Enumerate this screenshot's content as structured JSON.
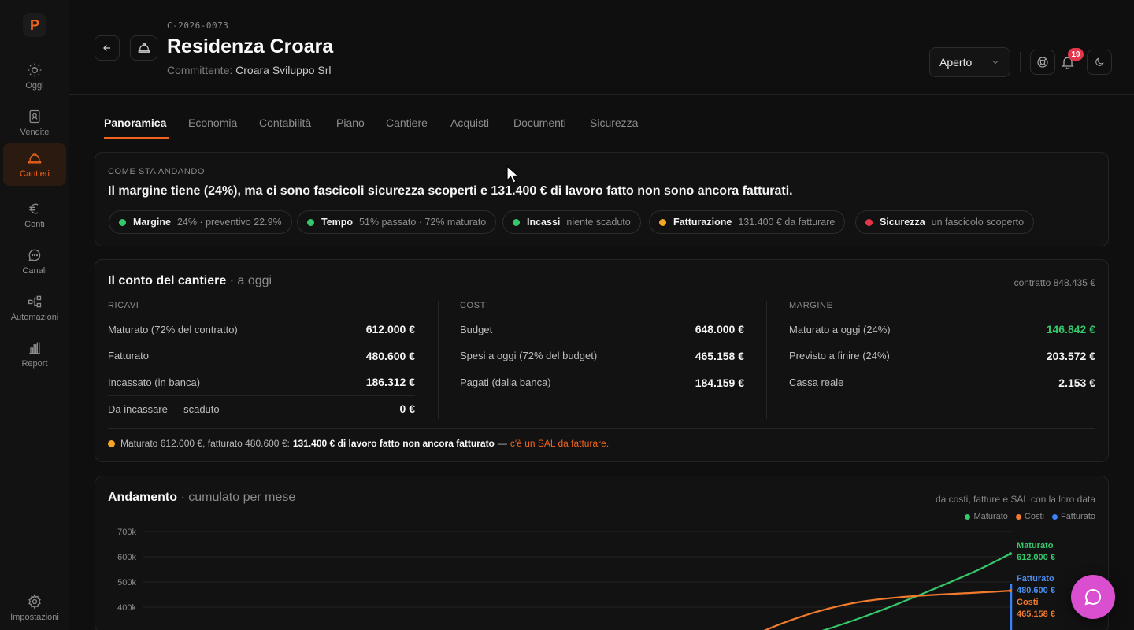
{
  "sidebar": {
    "logo": "P",
    "items": [
      {
        "label": "Oggi",
        "icon": "sun-icon"
      },
      {
        "label": "Vendite",
        "icon": "contact-book-icon"
      },
      {
        "label": "Cantieri",
        "icon": "hard-hat-icon"
      },
      {
        "label": "Conti",
        "icon": "euro-icon"
      },
      {
        "label": "Canali",
        "icon": "chat-icon"
      },
      {
        "label": "Automazioni",
        "icon": "workflow-icon"
      },
      {
        "label": "Report",
        "icon": "bar-chart-icon"
      }
    ],
    "settings_label": "Impostazioni"
  },
  "header": {
    "code": "C-2026-0073",
    "title": "Residenza Croara",
    "client_label": "Committente:",
    "client_name": "Croara Sviluppo Srl",
    "status": "Aperto",
    "notifications_count": "19"
  },
  "tabs": [
    "Panoramica",
    "Economia",
    "Contabilità",
    "Piano",
    "Cantiere",
    "Acquisti",
    "Documenti",
    "Sicurezza"
  ],
  "summary": {
    "overline": "COME STA ANDANDO",
    "headline": "Il margine tiene (24%), ma ci sono fascicoli sicurezza scoperti e 131.400 € di lavoro fatto non sono ancora fatturati.",
    "pills": [
      {
        "key": "Margine",
        "value": "24% · preventivo 22.9%",
        "color": "#35c76a"
      },
      {
        "key": "Tempo",
        "value": "51% passato · 72% maturato",
        "color": "#35c76a"
      },
      {
        "key": "Incassi",
        "value": "niente scaduto",
        "color": "#35c76a"
      },
      {
        "key": "Fatturazione",
        "value": "131.400 € da fatturare",
        "color": "#f5a623"
      },
      {
        "key": "Sicurezza",
        "value": "un fascicolo scoperto",
        "color": "#e5364b"
      }
    ]
  },
  "conto": {
    "title": "Il conto del cantiere",
    "subtitle": " · a oggi",
    "contract": "contratto 848.435 €",
    "ricavi": {
      "head": "RICAVI",
      "rows": [
        {
          "label": "Maturato (72% del contratto)",
          "value": "612.000 €"
        },
        {
          "label": "Fatturato",
          "value": "480.600 €"
        },
        {
          "label": "Incassato (in banca)",
          "value": "186.312 €"
        },
        {
          "label": "Da incassare — scaduto",
          "value": "0 €"
        }
      ]
    },
    "costi": {
      "head": "COSTI",
      "rows": [
        {
          "label": "Budget",
          "value": "648.000 €"
        },
        {
          "label": "Spesi a oggi (72% del budget)",
          "value": "465.158 €"
        },
        {
          "label": "Pagati (dalla banca)",
          "value": "184.159 €"
        }
      ]
    },
    "margine": {
      "head": "MARGINE",
      "rows": [
        {
          "label": "Maturato a oggi (24%)",
          "value": "146.842 €"
        },
        {
          "label": "Previsto a finire (24%)",
          "value": "203.572 €"
        },
        {
          "label": "Cassa reale",
          "value": "2.153 €"
        }
      ]
    },
    "note_prefix": "Maturato 612.000 €, fatturato 480.600 €:",
    "note_bold": "131.400 € di lavoro fatto non ancora fatturato",
    "note_dash": "—",
    "note_warn": "c'è un SAL da fatturare."
  },
  "andamento": {
    "title": "Andamento",
    "subtitle": " · cumulato per mese",
    "right_note": "da costi, fatture e SAL con la loro data",
    "legend": [
      {
        "name": "Maturato",
        "color": "#35c76a"
      },
      {
        "name": "Costi",
        "color": "#f07a2e"
      },
      {
        "name": "Fatturato",
        "color": "#3b82f6"
      }
    ],
    "end_labels": [
      {
        "name": "Maturato",
        "value": "612.000 €",
        "color": "#35c76a"
      },
      {
        "name": "Fatturato",
        "value": "480.600 €",
        "color": "#4d8ff0"
      },
      {
        "name": "Costi",
        "value": "465.158 €",
        "color": "#f07a2e"
      }
    ]
  },
  "chart_data": {
    "type": "line",
    "title": "Andamento",
    "ylim": [
      0,
      700000
    ],
    "y_ticks": [
      "700k",
      "600k",
      "500k",
      "400k"
    ],
    "y_tick_values": [
      700000,
      600000,
      500000,
      400000
    ],
    "grid": true,
    "legend": "top-right",
    "series": [
      {
        "name": "Maturato",
        "end_value": 612000
      },
      {
        "name": "Costi",
        "end_value": 465158
      },
      {
        "name": "Fatturato",
        "end_value": 480600
      }
    ]
  }
}
